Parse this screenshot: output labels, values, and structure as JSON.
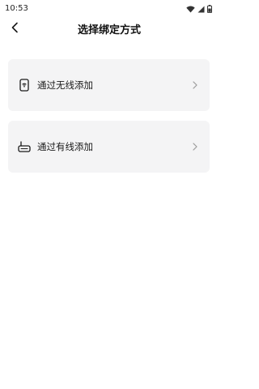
{
  "status_bar": {
    "time": "10:53",
    "icons": [
      "wifi-icon",
      "signal-icon",
      "battery-icon"
    ]
  },
  "nav": {
    "title": "选择绑定方式",
    "back_icon": "chevron-left-icon"
  },
  "options": [
    {
      "label": "通过无线添加",
      "icon": "wireless-device-icon",
      "trailing_icon": "chevron-right-icon"
    },
    {
      "label": "通过有线添加",
      "icon": "wired-router-icon",
      "trailing_icon": "chevron-right-icon"
    }
  ],
  "colors": {
    "background": "#ffffff",
    "card": "#f4f4f5",
    "text": "#1a1a1a",
    "chevron": "#9a9a9a"
  }
}
